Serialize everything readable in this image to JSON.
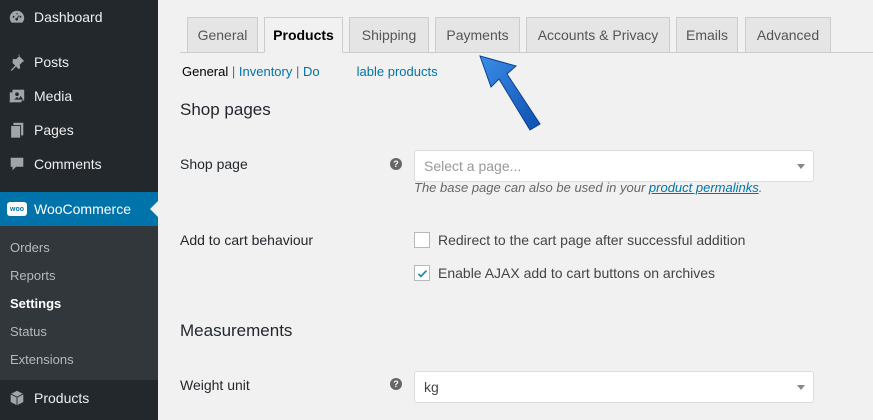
{
  "sidebar": {
    "items": [
      {
        "label": "Dashboard"
      },
      {
        "label": "Posts"
      },
      {
        "label": "Media"
      },
      {
        "label": "Pages"
      },
      {
        "label": "Comments"
      }
    ],
    "woocommerce": {
      "label": "WooCommerce",
      "icon_text": "woo"
    },
    "submenu": [
      "Orders",
      "Reports",
      "Settings",
      "Status",
      "Extensions"
    ],
    "products": {
      "label": "Products"
    }
  },
  "tabs": [
    "General",
    "Products",
    "Shipping",
    "Payments",
    "Accounts & Privacy",
    "Emails",
    "Advanced"
  ],
  "active_tab": "Products",
  "subsub": {
    "current": "General",
    "sep": "|",
    "inventory": "Inventory",
    "downloadable_partial": "Do",
    "downloadable_rest": "lable products"
  },
  "sections": {
    "shop_pages": "Shop pages",
    "measurements": "Measurements"
  },
  "shop_page": {
    "label": "Shop page",
    "help": "?",
    "placeholder": "Select a page...",
    "desc_prefix": "The base page can also be used in your",
    "desc_link": "product permalinks",
    "desc_suffix": "."
  },
  "cart_behaviour": {
    "label": "Add to cart behaviour",
    "redirect": {
      "label": "Redirect to the cart page after successful addition",
      "checked": false
    },
    "ajax": {
      "label": "Enable AJAX add to cart buttons on archives",
      "checked": true
    }
  },
  "weight_unit": {
    "label": "Weight unit",
    "help": "?",
    "value": "kg"
  },
  "colors": {
    "sidebar_bg": "#23282d",
    "accent": "#0073aa",
    "arrow": "#1e6fcf"
  }
}
